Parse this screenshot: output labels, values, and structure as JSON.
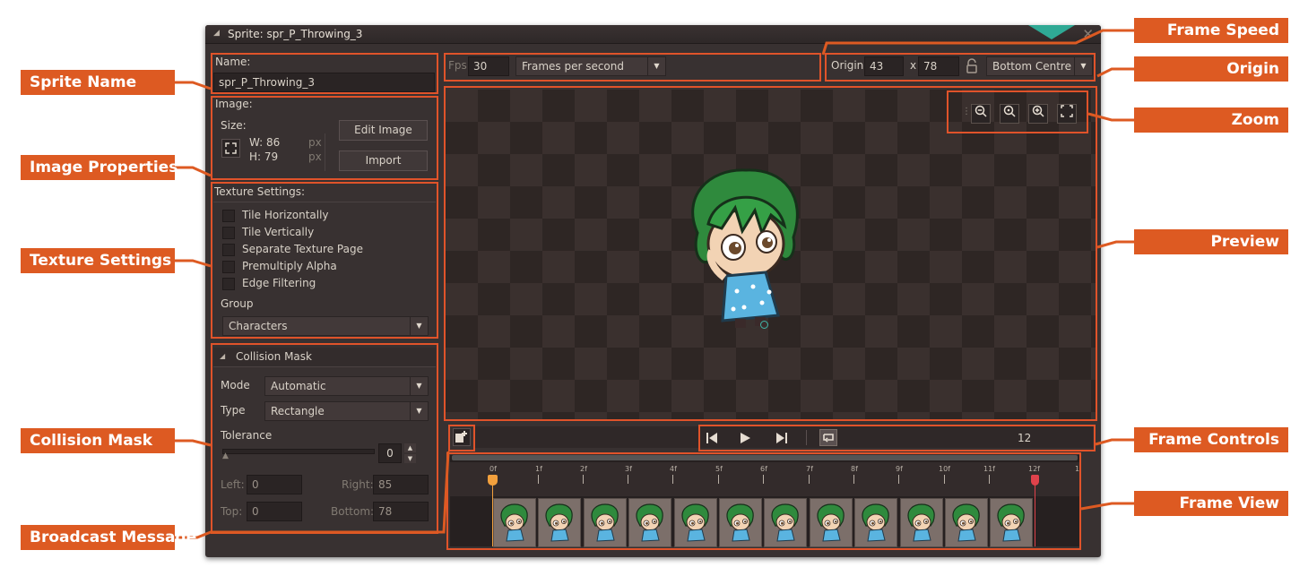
{
  "window": {
    "title": "Sprite: spr_P_Throwing_3",
    "close_label": "✕"
  },
  "name_section": {
    "label": "Name:",
    "value": "spr_P_Throwing_3"
  },
  "image_section": {
    "label": "Image:",
    "size_label": "Size:",
    "width_text": "W: 86",
    "height_text": "H: 79",
    "px_unit": "px",
    "edit_button": "Edit Image",
    "import_button": "Import"
  },
  "texture_settings": {
    "label": "Texture Settings:",
    "options": [
      "Tile Horizontally",
      "Tile Vertically",
      "Separate Texture Page",
      "Premultiply Alpha",
      "Edge Filtering"
    ],
    "group_label": "Group",
    "group_value": "Characters"
  },
  "collision_mask": {
    "header": "Collision Mask",
    "mode_label": "Mode",
    "mode_value": "Automatic",
    "type_label": "Type",
    "type_value": "Rectangle",
    "tolerance_label": "Tolerance",
    "tolerance_value": "0",
    "left_label": "Left:",
    "left_value": "0",
    "right_label": "Right:",
    "right_value": "85",
    "top_label": "Top:",
    "top_value": "0",
    "bottom_label": "Bottom:",
    "bottom_value": "78"
  },
  "speed": {
    "label": "Fps",
    "value": "30",
    "unit": "Frames per second"
  },
  "origin": {
    "label": "Origin",
    "x": "43",
    "x_sep": "x",
    "y": "78",
    "preset": "Bottom Centre"
  },
  "frame_controls": {
    "frame_count": "12"
  },
  "timeline": {
    "ticks": [
      "0f",
      "1f",
      "2f",
      "3f",
      "4f",
      "5f",
      "6f",
      "7f",
      "8f",
      "9f",
      "10f",
      "11f",
      "12f",
      "1"
    ],
    "frame_count": 12
  },
  "annotations": {
    "left": [
      "Sprite Name",
      "Image Properties",
      "Texture Settings",
      "Collision Mask",
      "Broadcast Message"
    ],
    "right": [
      "Frame Speed",
      "Origin",
      "Zoom",
      "Preview",
      "Frame Controls",
      "Frame View"
    ]
  },
  "colors": {
    "annotation": "#dd5a22",
    "accent": "#2fa995",
    "panel": "#383131"
  }
}
